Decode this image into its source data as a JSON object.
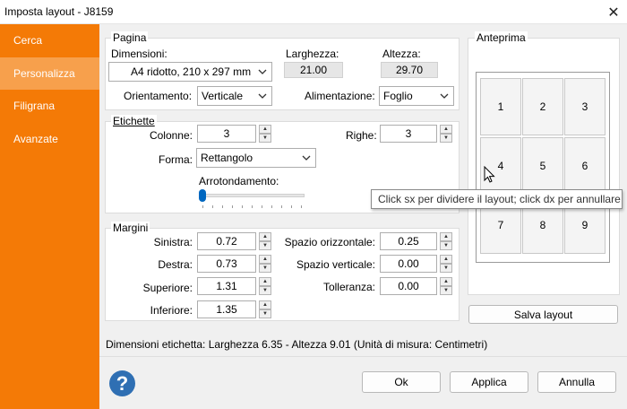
{
  "window": {
    "title": "Imposta layout - J8159"
  },
  "sidebar": {
    "items": [
      {
        "label": "Cerca"
      },
      {
        "label": "Personalizza"
      },
      {
        "label": "Filigrana"
      },
      {
        "label": "Avanzate"
      }
    ]
  },
  "pagina": {
    "legend": "Pagina",
    "dimensioni_label": "Dimensioni:",
    "dimensioni_value": "A4 ridotto, 210 x 297 mm",
    "larghezza_label": "Larghezza:",
    "larghezza_value": "21.00",
    "altezza_label": "Altezza:",
    "altezza_value": "29.70",
    "orientamento_label": "Orientamento:",
    "orientamento_value": "Verticale",
    "alimentazione_label": "Alimentazione:",
    "alimentazione_value": "Foglio"
  },
  "etichette": {
    "legend": "Etichette",
    "colonne_label": "Colonne:",
    "colonne_value": "3",
    "righe_label": "Righe:",
    "righe_value": "3",
    "forma_label": "Forma:",
    "forma_value": "Rettangolo",
    "arrotondamento_label": "Arrotondamento:",
    "arrotondamento_level": 0
  },
  "margini": {
    "legend": "Margini",
    "sinistra_label": "Sinistra:",
    "sinistra_value": "0.72",
    "destra_label": "Destra:",
    "destra_value": "0.73",
    "superiore_label": "Superiore:",
    "superiore_value": "1.31",
    "inferiore_label": "Inferiore:",
    "inferiore_value": "1.35",
    "spazio_orizzontale_label": "Spazio orizzontale:",
    "spazio_orizzontale_value": "0.25",
    "spazio_verticale_label": "Spazio verticale:",
    "spazio_verticale_value": "0.00",
    "tolleranza_label": "Tolleranza:",
    "tolleranza_value": "0.00"
  },
  "anteprima": {
    "legend": "Anteprima",
    "cells": [
      "1",
      "2",
      "3",
      "4",
      "5",
      "6",
      "7",
      "8",
      "9"
    ],
    "tooltip": "Click sx per dividere il layout; click dx per annullare",
    "salva_label": "Salva layout"
  },
  "status": "Dimensioni etichetta: Larghezza 6.35 - Altezza 9.01 (Unità di misura: Centimetri)",
  "buttons": {
    "ok": "Ok",
    "applica": "Applica",
    "annulla": "Annulla"
  },
  "help_glyph": "?",
  "icons": [
    "close-icon",
    "chevron-down-icon",
    "spin-up-icon",
    "spin-down-icon",
    "help-icon",
    "mouse-cursor-icon"
  ],
  "colors": {
    "sidebar": "#f47a06",
    "sidebar_active": "#f7a04c",
    "help": "#2f6fb3",
    "slider": "#0067c0"
  }
}
